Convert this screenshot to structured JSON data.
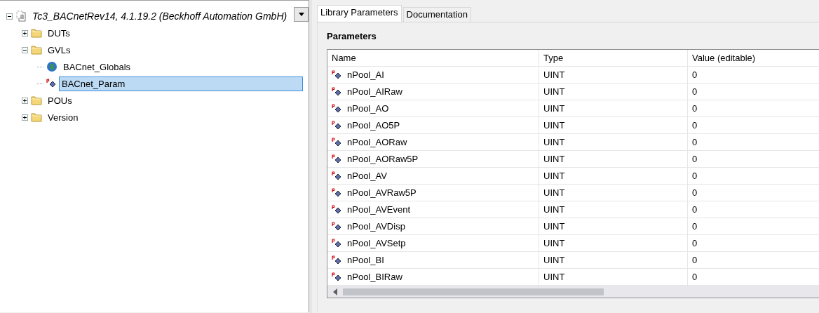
{
  "tree": {
    "label": "Tc3_BACnetRev14, 4.1.19.2 (Beckhoff Automation GmbH)",
    "kind": "library",
    "expanded": true,
    "children": [
      {
        "label": "DUTs",
        "kind": "folder",
        "expanded": false,
        "selected": false
      },
      {
        "label": "GVLs",
        "kind": "folder",
        "expanded": true,
        "selected": false,
        "children": [
          {
            "label": "BACnet_Globals",
            "kind": "globe",
            "selected": false
          },
          {
            "label": "BACnet_Param",
            "kind": "param",
            "selected": true
          }
        ]
      },
      {
        "label": "POUs",
        "kind": "folder",
        "expanded": false,
        "selected": false
      },
      {
        "label": "Version",
        "kind": "folder",
        "expanded": false,
        "selected": false
      }
    ]
  },
  "tabs": [
    {
      "label": "Library Parameters",
      "selected": true
    },
    {
      "label": "Documentation",
      "selected": false
    }
  ],
  "section_title": "Parameters",
  "table": {
    "columns": [
      "Name",
      "Type",
      "Value (editable)"
    ],
    "rows": [
      {
        "name": "nPool_AI",
        "type": "UINT",
        "value": "0"
      },
      {
        "name": "nPool_AIRaw",
        "type": "UINT",
        "value": "0"
      },
      {
        "name": "nPool_AO",
        "type": "UINT",
        "value": "0"
      },
      {
        "name": "nPool_AO5P",
        "type": "UINT",
        "value": "0"
      },
      {
        "name": "nPool_AORaw",
        "type": "UINT",
        "value": "0"
      },
      {
        "name": "nPool_AORaw5P",
        "type": "UINT",
        "value": "0"
      },
      {
        "name": "nPool_AV",
        "type": "UINT",
        "value": "0"
      },
      {
        "name": "nPool_AVRaw5P",
        "type": "UINT",
        "value": "0"
      },
      {
        "name": "nPool_AVEvent",
        "type": "UINT",
        "value": "0"
      },
      {
        "name": "nPool_AVDisp",
        "type": "UINT",
        "value": "0"
      },
      {
        "name": "nPool_AVSetp",
        "type": "UINT",
        "value": "0"
      },
      {
        "name": "nPool_BI",
        "type": "UINT",
        "value": "0"
      },
      {
        "name": "nPool_BIRaw",
        "type": "UINT",
        "value": "0"
      }
    ]
  }
}
